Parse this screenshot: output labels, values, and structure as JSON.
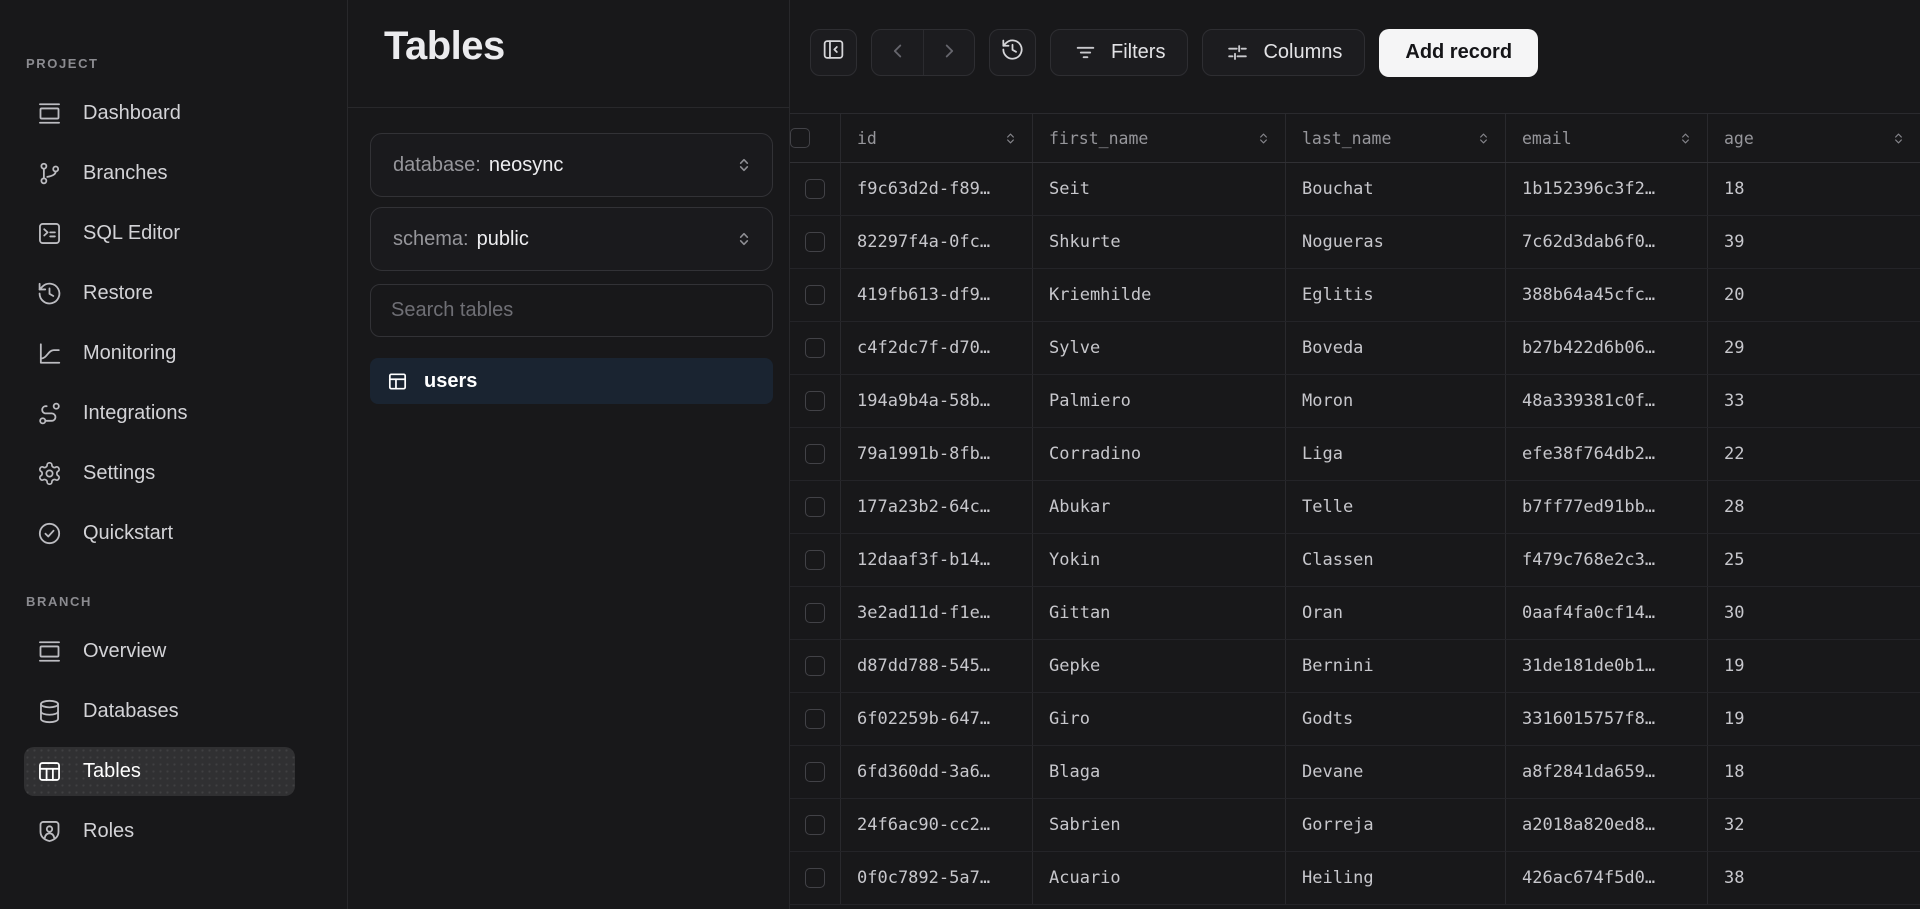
{
  "sidebar": {
    "sections": [
      {
        "label": "PROJECT",
        "items": [
          {
            "label": "Dashboard",
            "icon": "dashboard"
          },
          {
            "label": "Branches",
            "icon": "branches"
          },
          {
            "label": "SQL Editor",
            "icon": "sql-editor"
          },
          {
            "label": "Restore",
            "icon": "restore"
          },
          {
            "label": "Monitoring",
            "icon": "monitoring"
          },
          {
            "label": "Integrations",
            "icon": "integrations"
          },
          {
            "label": "Settings",
            "icon": "settings"
          },
          {
            "label": "Quickstart",
            "icon": "quickstart"
          }
        ]
      },
      {
        "label": "BRANCH",
        "items": [
          {
            "label": "Overview",
            "icon": "overview"
          },
          {
            "label": "Databases",
            "icon": "databases"
          },
          {
            "label": "Tables",
            "icon": "tables",
            "active": true
          },
          {
            "label": "Roles",
            "icon": "roles"
          }
        ]
      }
    ]
  },
  "panel": {
    "title": "Tables",
    "database_select": {
      "label": "database:",
      "value": "neosync"
    },
    "schema_select": {
      "label": "schema:",
      "value": "public"
    },
    "search_placeholder": "Search tables",
    "tables": [
      {
        "name": "users",
        "icon": "table-grid",
        "active": true
      }
    ]
  },
  "toolbar": {
    "filters_label": "Filters",
    "columns_label": "Columns",
    "add_record_label": "Add record"
  },
  "table": {
    "columns": [
      "id",
      "first_name",
      "last_name",
      "email",
      "age"
    ],
    "rows": [
      [
        "f9c63d2d-f89…",
        "Seit",
        "Bouchat",
        "1b152396c3f2…",
        "18"
      ],
      [
        "82297f4a-0fc…",
        "Shkurte",
        "Nogueras",
        "7c62d3dab6f0…",
        "39"
      ],
      [
        "419fb613-df9…",
        "Kriemhilde",
        "Eglitis",
        "388b64a45cfc…",
        "20"
      ],
      [
        "c4f2dc7f-d70…",
        "Sylve",
        "Boveda",
        "b27b422d6b06…",
        "29"
      ],
      [
        "194a9b4a-58b…",
        "Palmiero",
        "Moron",
        "48a339381c0f…",
        "33"
      ],
      [
        "79a1991b-8fb…",
        "Corradino",
        "Liga",
        "efe38f764db2…",
        "22"
      ],
      [
        "177a23b2-64c…",
        "Abukar",
        "Telle",
        "b7ff77ed91bb…",
        "28"
      ],
      [
        "12daaf3f-b14…",
        "Yokin",
        "Classen",
        "f479c768e2c3…",
        "25"
      ],
      [
        "3e2ad11d-f1e…",
        "Gittan",
        "Oran",
        "0aaf4fa0cf14…",
        "30"
      ],
      [
        "d87dd788-545…",
        "Gepke",
        "Bernini",
        "31de181de0b1…",
        "19"
      ],
      [
        "6f02259b-647…",
        "Giro",
        "Godts",
        "3316015757f8…",
        "19"
      ],
      [
        "6fd360dd-3a6…",
        "Blaga",
        "Devane",
        "a8f2841da659…",
        "18"
      ],
      [
        "24f6ac90-cc2…",
        "Sabrien",
        "Gorreja",
        "a2018a820ed8…",
        "32"
      ],
      [
        "0f0c7892-5a7…",
        "Acuario",
        "Heiling",
        "426ac674f5d0…",
        "38"
      ]
    ]
  },
  "colors": {
    "page_bg": "#18181a",
    "selected_table_bg": "#1a2431",
    "active_nav_bg": "#303032",
    "add_record_bg": "#f5f5f6",
    "border": "#28282b"
  }
}
